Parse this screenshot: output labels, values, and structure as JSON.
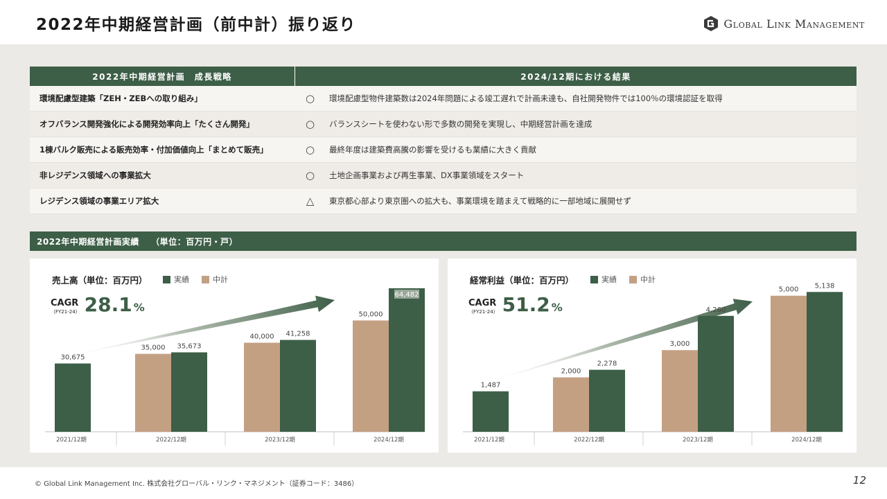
{
  "header": {
    "title": "2022年中期経営計画（前中計）振り返り",
    "logo_text": "Global Link Management",
    "logo_icon": "gl-logo-icon"
  },
  "table": {
    "col1_header": "2022年中期経営計画　成長戦略",
    "col2_header": "2024/12期における結果",
    "rows": [
      {
        "strategy": "環境配慮型建築「ZEH・ZEBへの取り組み」",
        "mark": "○",
        "result": "環境配慮型物件建築数は2024年問題による竣工遅れで計画未達も、自社開発物件では100％の環境認証を取得"
      },
      {
        "strategy": "オフバランス開発強化による開発効率向上「たくさん開発」",
        "mark": "○",
        "result": "バランスシートを使わない形で多数の開発を実現し、中期経営計画を達成"
      },
      {
        "strategy": "1棟バルク販売による販売効率・付加価値向上「まとめて販売」",
        "mark": "○",
        "result": "最終年度は建築費高騰の影響を受けるも業績に大きく貢献"
      },
      {
        "strategy": "非レジデンス領域への事業拡大",
        "mark": "○",
        "result": "土地企画事業および再生事業、DX事業領域をスタート"
      },
      {
        "strategy": "レジデンス領域の事業エリア拡大",
        "mark": "△",
        "result": "東京都心部より東京圏への拡大も、事業環境を踏まえて戦略的に一部地域に展開せず"
      }
    ]
  },
  "section": {
    "title": "2022年中期経営計画実績　 （単位：百万円・戸）"
  },
  "colors": {
    "actual": "#3d5e47",
    "plan": "#c4a083",
    "header_bg": "#3d5e47",
    "content_bg": "#eceae6"
  },
  "chart_data": [
    {
      "type": "bar",
      "title": "売上高（単位：百万円）",
      "categories": [
        "2021/12期",
        "2022/12期",
        "2023/12期",
        "2024/12期"
      ],
      "series": [
        {
          "name": "中計",
          "values": [
            null,
            35000,
            40000,
            50000
          ],
          "labels": [
            "",
            "35,000",
            "40,000",
            "50,000"
          ]
        },
        {
          "name": "実績",
          "values": [
            30675,
            35673,
            41258,
            64482
          ],
          "labels": [
            "30,675",
            "35,673",
            "41,258",
            "64,482"
          ]
        }
      ],
      "cagr_label": "CAGR",
      "cagr_sub": "（FY21-24）",
      "cagr_value": "28.1",
      "cagr_unit": "%",
      "ylim": [
        0,
        66000
      ],
      "grid": false,
      "legend": "top"
    },
    {
      "type": "bar",
      "title": "経常利益（単位：百万円）",
      "categories": [
        "2021/12期",
        "2022/12期",
        "2023/12期",
        "2024/12期"
      ],
      "series": [
        {
          "name": "中計",
          "values": [
            null,
            2000,
            3000,
            5000
          ],
          "labels": [
            "",
            "2,000",
            "3,000",
            "5,000"
          ]
        },
        {
          "name": "実績",
          "values": [
            1487,
            2278,
            4260,
            5138
          ],
          "labels": [
            "1,487",
            "2,278",
            "4,260",
            "5,138"
          ]
        }
      ],
      "cagr_label": "CAGR",
      "cagr_sub": "（FY21-24）",
      "cagr_value": "51.2",
      "cagr_unit": "%",
      "ylim": [
        0,
        5400
      ],
      "grid": false,
      "legend": "top"
    }
  ],
  "footer": {
    "copyright": "© Global Link Management Inc.  株式会社グローバル・リンク・マネジメント（証券コード：3486）",
    "page_number": "12"
  }
}
